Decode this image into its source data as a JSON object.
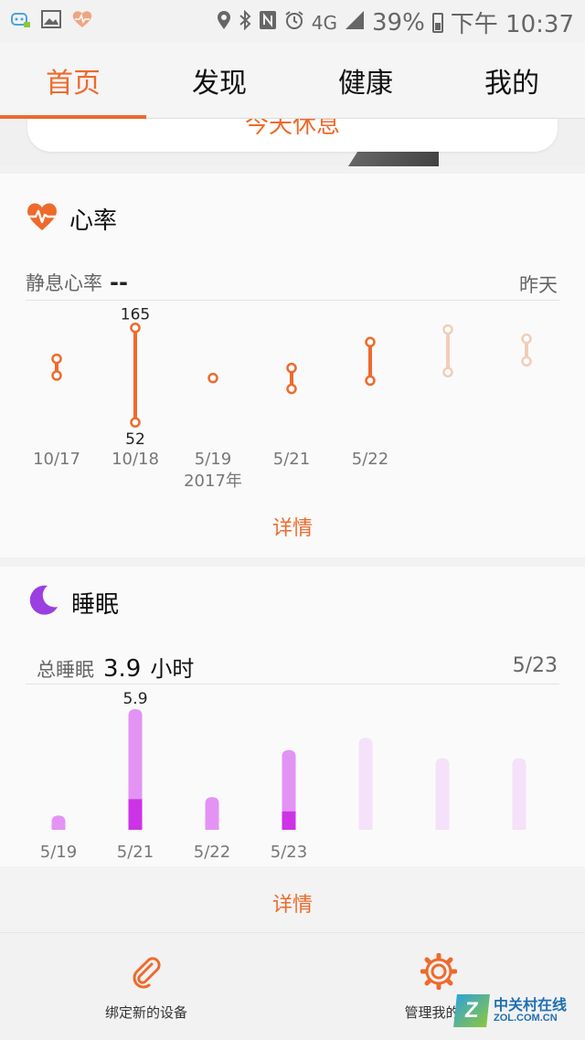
{
  "status_bar": {
    "network": "4G",
    "battery": "39%",
    "time": "下午 10:37",
    "icons_left": [
      "notification-bot-icon",
      "image-icon",
      "health-heart-icon"
    ],
    "icons_right": [
      "location-icon",
      "bluetooth-icon",
      "nfc-icon",
      "alarm-icon",
      "signal-icon",
      "battery-icon"
    ]
  },
  "tabs": [
    {
      "label": "首页",
      "active": true
    },
    {
      "label": "发现",
      "active": false
    },
    {
      "label": "健康",
      "active": false
    },
    {
      "label": "我的",
      "active": false
    }
  ],
  "scrolled_card": {
    "text": "今天休息"
  },
  "heart_rate": {
    "title": "心率",
    "resting_label": "静息心率",
    "resting_value": "--",
    "date_label": "昨天",
    "detail": "详情",
    "accent": "#ee6a2c",
    "faded": "#f1cdb8",
    "points": [
      {
        "date": "10/17",
        "sub": "",
        "low": 108,
        "high": 128,
        "faded": false,
        "show_labels": false
      },
      {
        "date": "10/18",
        "sub": "",
        "low": 52,
        "high": 165,
        "faded": false,
        "show_labels": true
      },
      {
        "date": "5/19",
        "sub": "2017年",
        "low": 105,
        "high": 105,
        "faded": false,
        "show_labels": false
      },
      {
        "date": "5/21",
        "sub": "",
        "low": 92,
        "high": 117,
        "faded": false,
        "show_labels": false
      },
      {
        "date": "5/22",
        "sub": "",
        "low": 102,
        "high": 148,
        "faded": false,
        "show_labels": false
      },
      {
        "date": "",
        "sub": "",
        "low": 112,
        "high": 163,
        "faded": true,
        "show_labels": false
      },
      {
        "date": "",
        "sub": "",
        "low": 125,
        "high": 152,
        "faded": true,
        "show_labels": false
      }
    ],
    "max_label": "165",
    "min_label": "52"
  },
  "sleep": {
    "title": "睡眠",
    "total_label": "总睡眠",
    "total_value": "3.9",
    "unit": "小时",
    "date_label": "5/23",
    "detail": "详情",
    "colors": {
      "light": "#e393f4",
      "deep": "#cc33e6",
      "faded": "#f5e1f9"
    },
    "bars": [
      {
        "date": "5/19",
        "total": 0.7,
        "deep": 0,
        "faded": false,
        "label": ""
      },
      {
        "date": "5/21",
        "total": 5.9,
        "deep": 1.5,
        "faded": false,
        "label": "5.9"
      },
      {
        "date": "5/22",
        "total": 1.6,
        "deep": 0,
        "faded": false,
        "label": ""
      },
      {
        "date": "5/23",
        "total": 3.9,
        "deep": 0.9,
        "faded": false,
        "label": ""
      },
      {
        "date": "",
        "total": 4.5,
        "deep": 0,
        "faded": true,
        "label": ""
      },
      {
        "date": "",
        "total": 3.5,
        "deep": 0,
        "faded": true,
        "label": ""
      },
      {
        "date": "",
        "total": 3.5,
        "deep": 0,
        "faded": true,
        "label": ""
      }
    ]
  },
  "bottom": {
    "bind_device": "绑定新的设备",
    "manage_device": "管理我的一"
  },
  "watermark": {
    "cn": "中关村在线",
    "en": "ZOL.COM.CN",
    "logo": "Z"
  }
}
